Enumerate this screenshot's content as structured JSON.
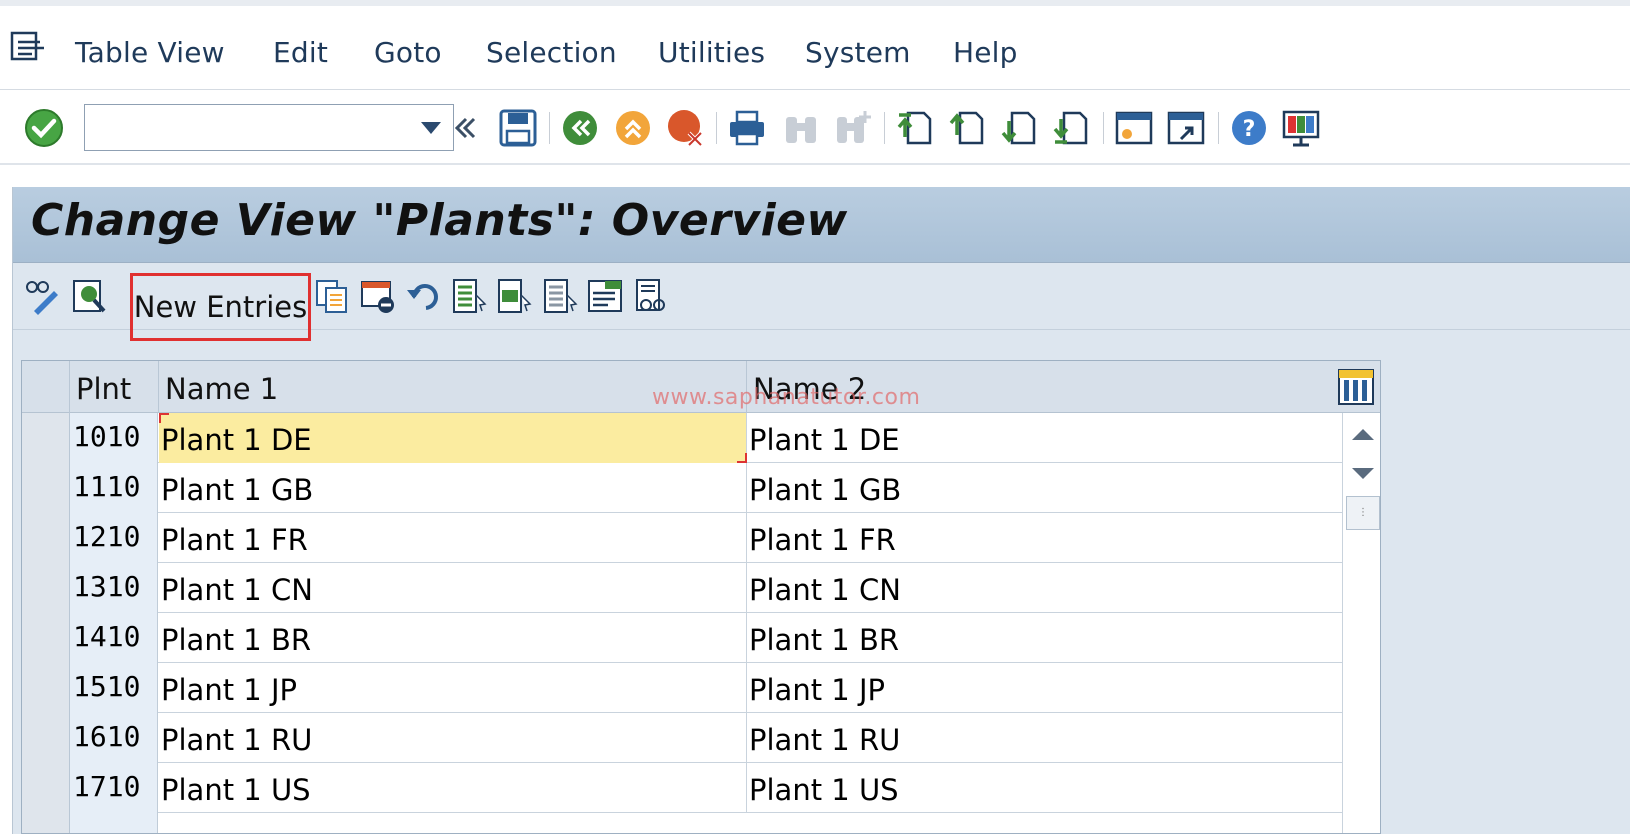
{
  "menu": {
    "items": [
      {
        "label": "Table View",
        "name": "menu-table-view"
      },
      {
        "label": "Edit",
        "name": "menu-edit"
      },
      {
        "label": "Goto",
        "name": "menu-goto"
      },
      {
        "label": "Selection",
        "name": "menu-selection"
      },
      {
        "label": "Utilities",
        "name": "menu-utilities"
      },
      {
        "label": "System",
        "name": "menu-system"
      },
      {
        "label": "Help",
        "name": "menu-help"
      }
    ]
  },
  "command_field": {
    "value": ""
  },
  "page": {
    "title": "Change View \"Plants\": Overview"
  },
  "app_toolbar": {
    "new_entries_label": "New Entries"
  },
  "table": {
    "columns": [
      "Plnt",
      "Name 1",
      "Name 2"
    ],
    "rows": [
      {
        "plnt": "1010",
        "name1": "Plant 1 DE",
        "name2": "Plant 1 DE"
      },
      {
        "plnt": "1110",
        "name1": "Plant 1 GB",
        "name2": "Plant 1 GB"
      },
      {
        "plnt": "1210",
        "name1": "Plant 1 FR",
        "name2": "Plant 1 FR"
      },
      {
        "plnt": "1310",
        "name1": "Plant 1 CN",
        "name2": "Plant 1 CN"
      },
      {
        "plnt": "1410",
        "name1": "Plant 1 BR",
        "name2": "Plant 1 BR"
      },
      {
        "plnt": "1510",
        "name1": "Plant 1 JP",
        "name2": "Plant 1 JP"
      },
      {
        "plnt": "1610",
        "name1": "Plant 1 RU",
        "name2": "Plant 1 RU"
      },
      {
        "plnt": "1710",
        "name1": "Plant 1 US",
        "name2": "Plant 1 US"
      }
    ]
  },
  "watermark": "www.saphanatutor.com",
  "colors": {
    "accent": "#e03030",
    "focus_cell": "#fbeca0",
    "title_bar": "#b9cde0"
  }
}
